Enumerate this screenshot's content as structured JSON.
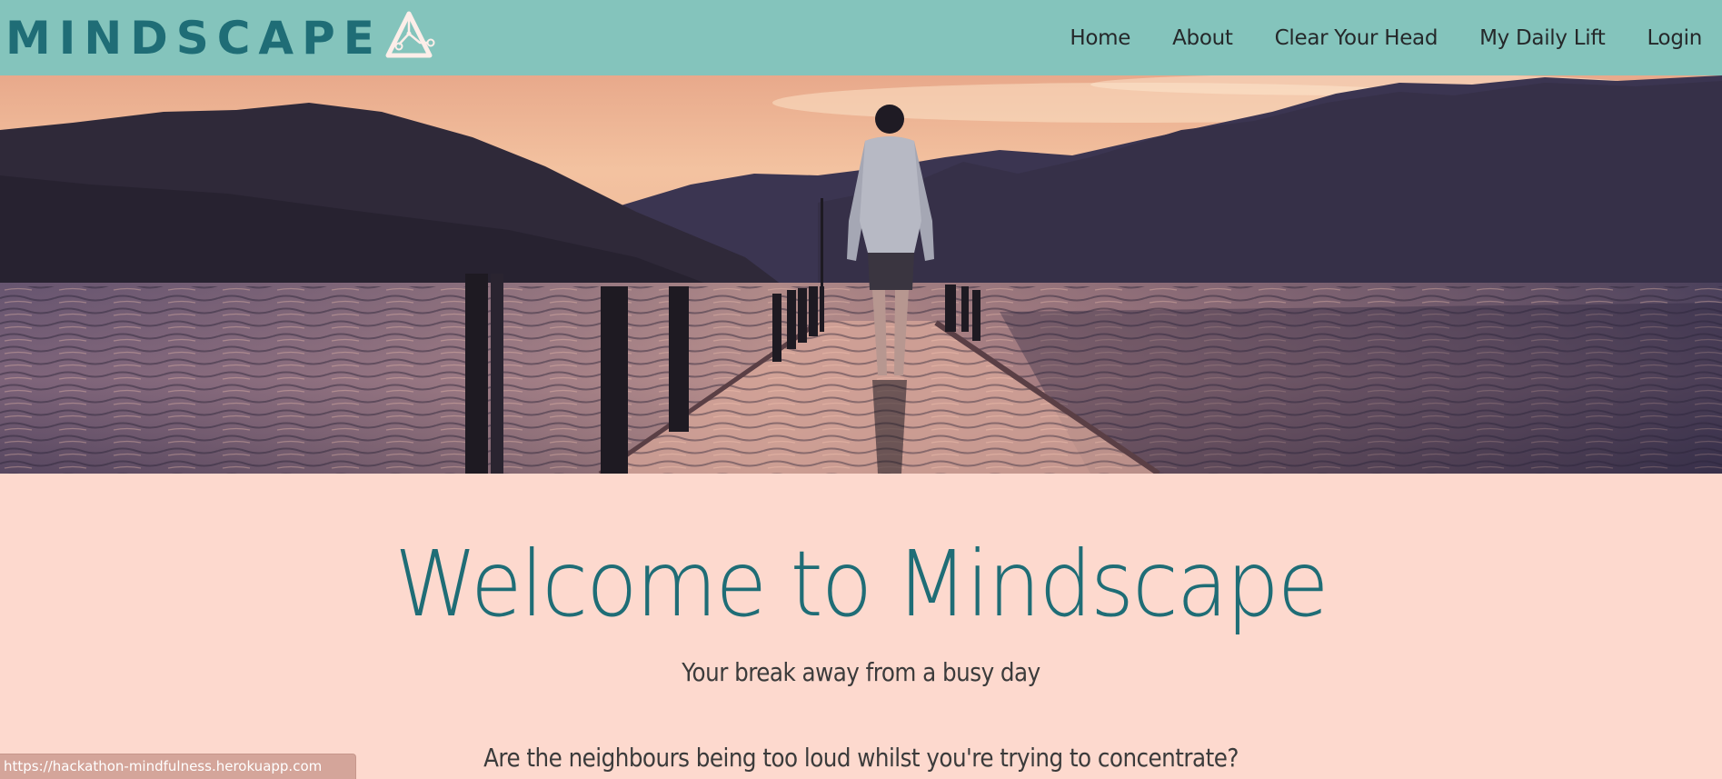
{
  "brand": {
    "name": "MINDSCAPE",
    "logo_icon": "letter-a-circuit-logo"
  },
  "nav": {
    "items": [
      {
        "label": "Home"
      },
      {
        "label": "About"
      },
      {
        "label": "Clear Your Head"
      },
      {
        "label": "My Daily Lift"
      },
      {
        "label": "Login"
      }
    ]
  },
  "hero": {
    "image": "man-standing-on-flooded-pier-at-sunset-lake"
  },
  "welcome": {
    "title": "Welcome to Mindscape",
    "subtitle": "Your break away from a busy day",
    "body": "Are the neighbours being too loud whilst you're trying to concentrate?"
  },
  "status_bar": {
    "url": "https://hackathon-mindfulness.herokuapp.com"
  },
  "colors": {
    "navbar_bg": "#84c4bc",
    "brand_teal": "#1f6d76",
    "page_bg": "#fdd9ce",
    "nav_text": "#25282a"
  }
}
